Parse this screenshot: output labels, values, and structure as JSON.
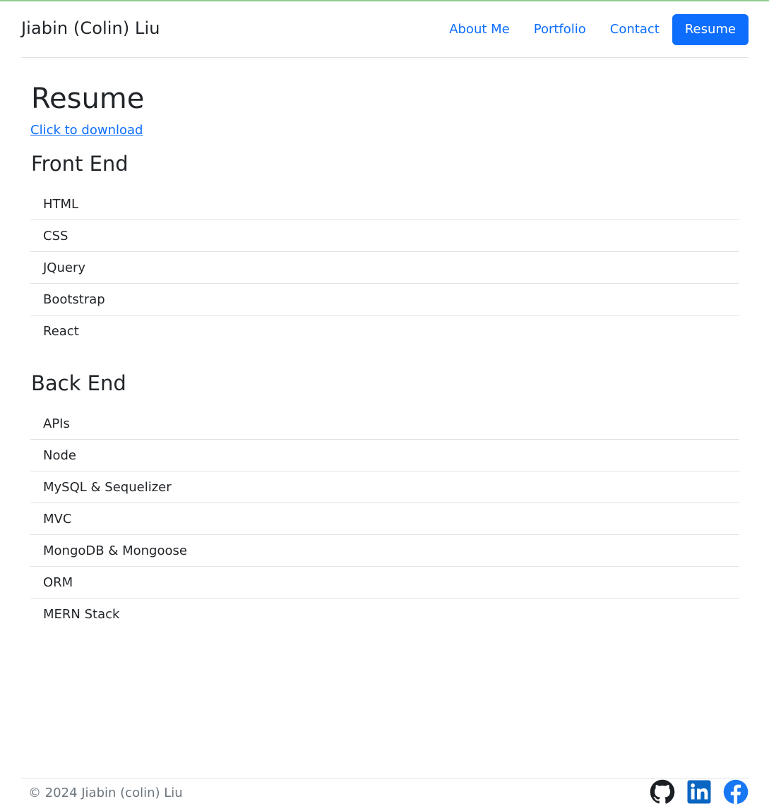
{
  "brand": "Jiabin (Colin) Liu",
  "nav": [
    {
      "label": "About Me",
      "active": false
    },
    {
      "label": "Portfolio",
      "active": false
    },
    {
      "label": "Contact",
      "active": false
    },
    {
      "label": "Resume",
      "active": true
    }
  ],
  "page": {
    "title": "Resume",
    "download_link": "Click to download"
  },
  "sections": [
    {
      "title": "Front End",
      "items": [
        "HTML",
        "CSS",
        "JQuery",
        "Bootstrap",
        "React"
      ]
    },
    {
      "title": "Back End",
      "items": [
        "APIs",
        "Node",
        "MySQL & Sequelizer",
        "MVC",
        "MongoDB & Mongoose",
        "ORM",
        "MERN Stack"
      ]
    }
  ],
  "footer": {
    "copyright": "© 2024 Jiabin (colin) Liu",
    "socials": [
      {
        "icon": "github-icon",
        "color": "#212529"
      },
      {
        "icon": "linkedin-icon",
        "color": "#0a66c2"
      },
      {
        "icon": "facebook-icon",
        "color": "#1877f2"
      }
    ]
  },
  "colors": {
    "accent": "#0d6efd",
    "text": "#212529",
    "muted": "#6c757d",
    "divider": "#dee2e6"
  }
}
